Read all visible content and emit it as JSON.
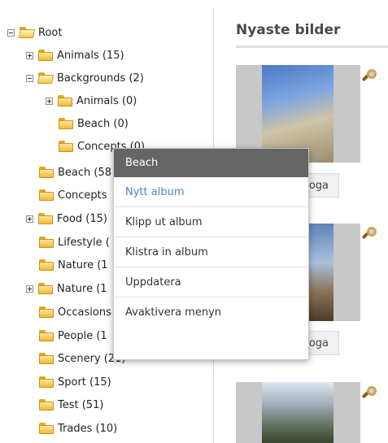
{
  "tree": {
    "rows": [
      {
        "label": "Root",
        "toggle": "minus",
        "open": true
      },
      {
        "label": "Animals (15)",
        "toggle": "plus",
        "open": false
      },
      {
        "label": "Backgrounds (2)",
        "toggle": "minus",
        "open": true
      },
      {
        "label": "Animals (0)",
        "toggle": "plus",
        "open": false
      },
      {
        "label": "Beach (0)",
        "toggle": "",
        "open": false
      },
      {
        "label": "Concepts (0)",
        "toggle": "",
        "open": false
      },
      {
        "label": "Beach (58",
        "toggle": "",
        "open": false
      },
      {
        "label": "Concepts",
        "toggle": "",
        "open": false
      },
      {
        "label": "Food (15)",
        "toggle": "plus",
        "open": false
      },
      {
        "label": "Lifestyle (",
        "toggle": "",
        "open": false
      },
      {
        "label": "Nature (1",
        "toggle": "",
        "open": false
      },
      {
        "label": "Nature (1",
        "toggle": "plus",
        "open": false
      },
      {
        "label": "Occasions",
        "toggle": "",
        "open": false
      },
      {
        "label": "People (1",
        "toggle": "",
        "open": false
      },
      {
        "label": "Scenery (21)",
        "toggle": "",
        "open": false
      },
      {
        "label": "Sport (15)",
        "toggle": "",
        "open": false
      },
      {
        "label": "Test (51)",
        "toggle": "",
        "open": false
      },
      {
        "label": "Trades (10)",
        "toggle": "",
        "open": false
      }
    ]
  },
  "main": {
    "heading": "Nyaste bilder",
    "button_label": "oga"
  },
  "context_menu": {
    "title": "Beach",
    "items": [
      {
        "label": "Nytt album",
        "active": true
      },
      {
        "label": "Klipp ut album",
        "active": false
      },
      {
        "label": "Klistra in album",
        "active": false
      },
      {
        "label": "Uppdatera",
        "active": false
      },
      {
        "label": "Avaktivera menyn",
        "active": false
      }
    ]
  },
  "colors": {
    "menu_header": "#656565",
    "menu_active": "#4a86c8",
    "folder": "#f0b935"
  }
}
